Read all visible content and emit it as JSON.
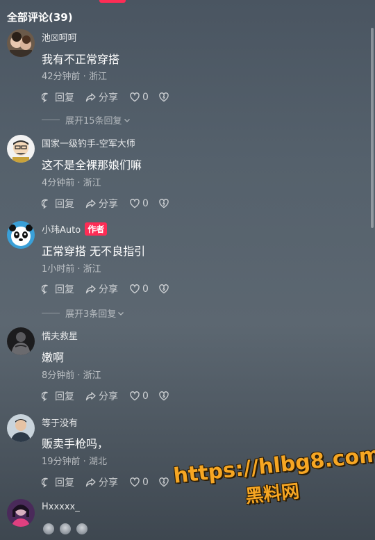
{
  "header": {
    "title": "全部评论(39)"
  },
  "labels": {
    "reply": "回复",
    "share": "分享"
  },
  "comments": [
    {
      "author": "池☒呵呵",
      "text": "我有不正常穿搭",
      "meta": "42分钟前 · 浙江",
      "likes": "0",
      "expand": "展开15条回复"
    },
    {
      "author": "国家一级钓手-空军大师",
      "text": "这不是全裸那娘们嘛",
      "meta": "4分钟前 · 浙江",
      "likes": "0"
    },
    {
      "author": "小玮Auto",
      "badge": "作者",
      "text": "正常穿搭 无不良指引",
      "meta": "1小时前 · 浙江",
      "likes": "0",
      "expand": "展开3条回复"
    },
    {
      "author": "懦夫救星",
      "text": "嫩啊",
      "meta": "8分钟前 · 浙江",
      "likes": "0"
    },
    {
      "author": "等于没有",
      "text": "贩卖手枪吗，",
      "meta": "19分钟前 · 湖北",
      "likes": "0"
    },
    {
      "author": "Hxxxxx_"
    }
  ],
  "watermark": {
    "url": "https://hlbg8.com",
    "name": "黑料网"
  },
  "colors": {
    "accent": "#fe2c55",
    "watermark": "#f6a623"
  },
  "icons": [
    "reply-icon",
    "share-icon",
    "heart-icon",
    "dislike-icon",
    "chevron-down-icon"
  ]
}
